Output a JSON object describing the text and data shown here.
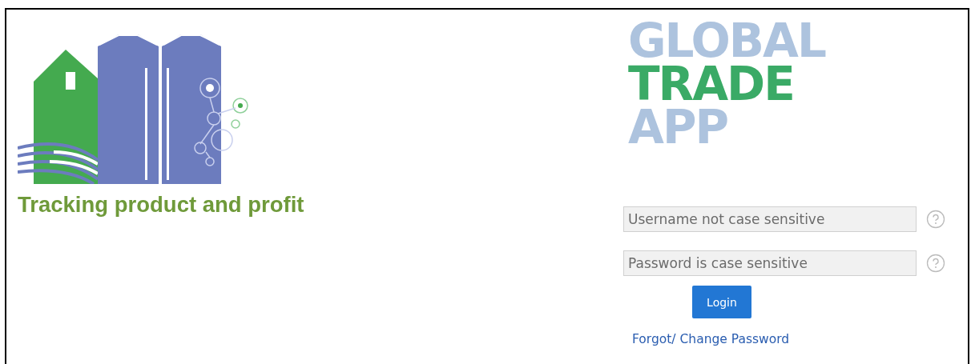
{
  "brand": {
    "tagline": "Tracking product and profit",
    "title_lines": [
      {
        "text": "GLOBAL",
        "color": "#adc3de"
      },
      {
        "text": "TRADE",
        "color": "#3aaa66"
      },
      {
        "text": "APP",
        "color": "#adc3de"
      }
    ]
  },
  "login": {
    "fields": [
      {
        "placeholder": "Username not case sensitive"
      },
      {
        "placeholder": "Password is case sensitive"
      }
    ],
    "button": "Login",
    "link": "Forgot/ Change Password"
  }
}
